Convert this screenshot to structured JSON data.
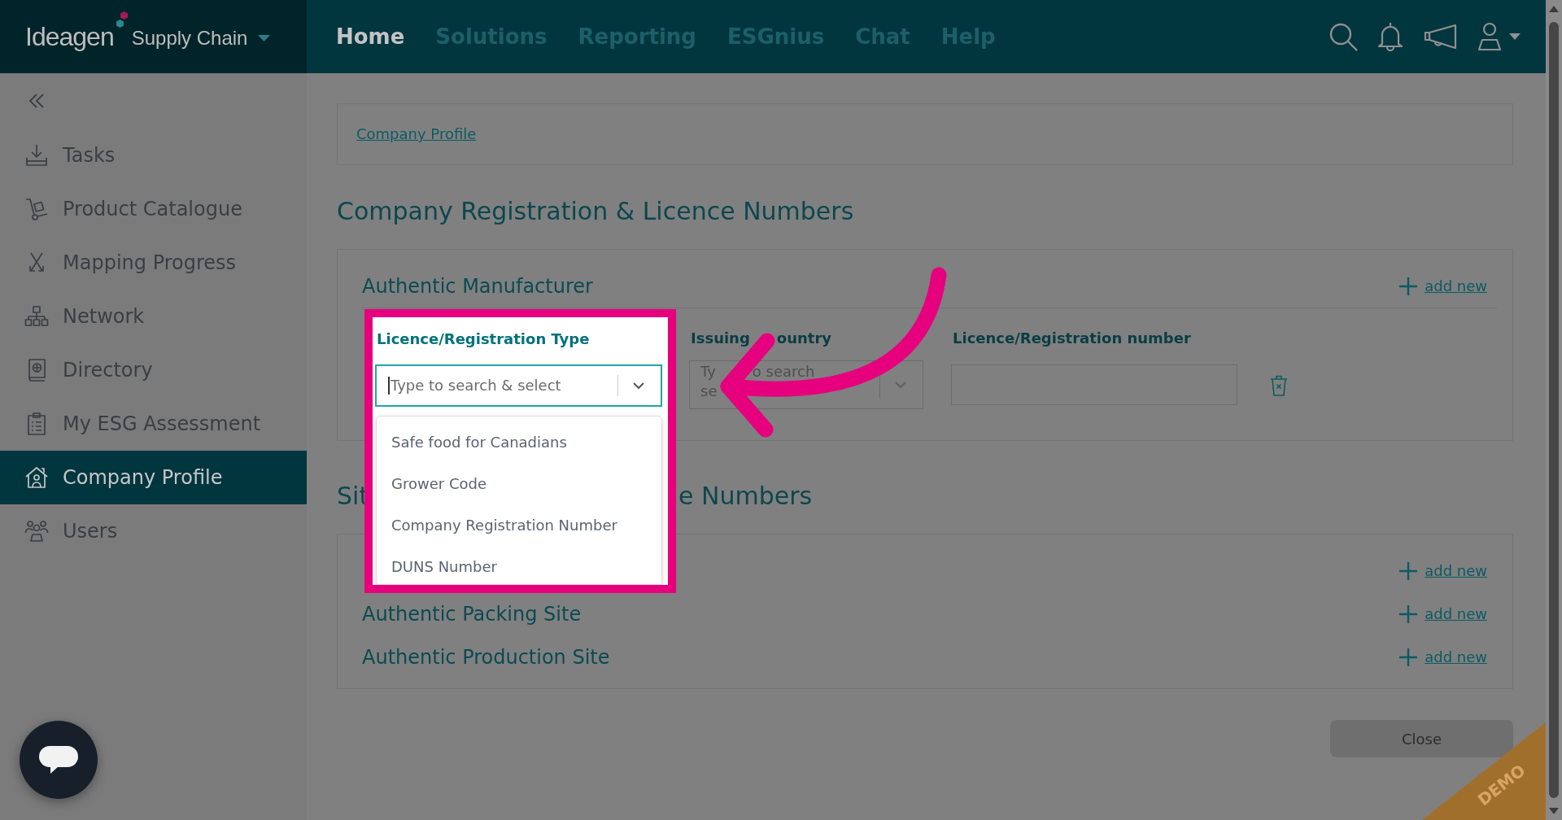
{
  "header": {
    "brand": "Ideagen",
    "product": "Supply Chain",
    "nav": [
      {
        "label": "Home",
        "selected": true
      },
      {
        "label": "Solutions",
        "selected": false
      },
      {
        "label": "Reporting",
        "selected": false
      },
      {
        "label": "ESGnius",
        "selected": false
      },
      {
        "label": "Chat",
        "selected": false
      },
      {
        "label": "Help",
        "selected": false
      }
    ]
  },
  "sidebar": {
    "items": [
      {
        "label": "Tasks",
        "selected": false
      },
      {
        "label": "Product Catalogue",
        "selected": false
      },
      {
        "label": "Mapping Progress",
        "selected": false
      },
      {
        "label": "Network",
        "selected": false
      },
      {
        "label": "Directory",
        "selected": false
      },
      {
        "label": "My ESG Assessment",
        "selected": false
      },
      {
        "label": "Company Profile",
        "selected": true
      },
      {
        "label": "Users",
        "selected": false
      }
    ]
  },
  "breadcrumb": {
    "link": "Company Profile"
  },
  "registration": {
    "title": "Company Registration & Licence Numbers",
    "panel": {
      "title": "Authentic Manufacturer",
      "add_link": "add new",
      "fields": [
        {
          "kind": "select",
          "label": "Licence/Registration Type",
          "placeholder": "Type to search & select",
          "focused": true,
          "expanded": true,
          "highlighted": true,
          "options": [
            "Safe food for Canadians",
            "Grower Code",
            "Company Registration Number",
            "DUNS Number"
          ]
        },
        {
          "kind": "select",
          "label": [
            "Issuing",
            "ountry"
          ],
          "placeholder": [
            "Ty",
            "o search",
            "se"
          ],
          "focused": false,
          "expanded": false,
          "highlighted": false
        },
        {
          "kind": "text",
          "label": "Licence/Registration number"
        }
      ]
    }
  },
  "sites": {
    "title_fragments": [
      "Sit",
      "e Numbers"
    ],
    "rows": [
      {
        "add_link": "add new"
      },
      {
        "title": "Authentic Packing Site",
        "add_link": "add new"
      },
      {
        "title": "Authentic Production Site",
        "add_link": "add new"
      }
    ]
  },
  "close_button": "Close",
  "demo_ribbon": "DEMO"
}
